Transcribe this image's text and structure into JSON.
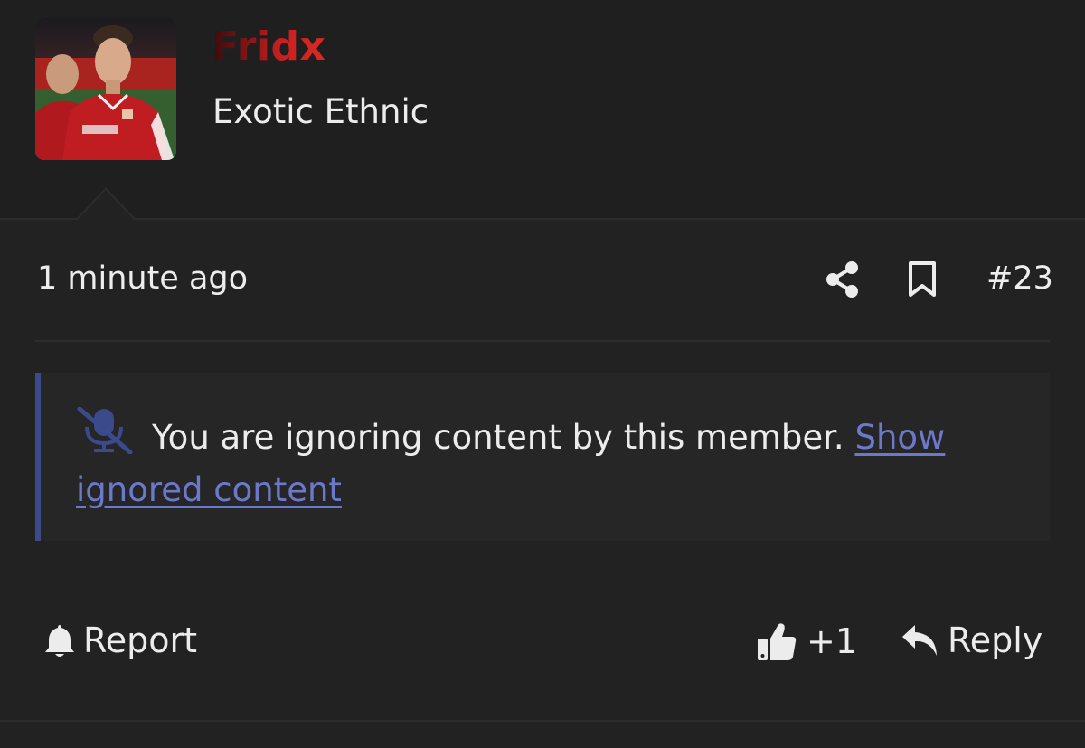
{
  "user": {
    "username": "Fridx",
    "user_title": "Exotic Ethnic",
    "avatar_icon": "avatar-photo"
  },
  "post": {
    "time": "1 minute ago",
    "number": "#23",
    "share_icon": "share-icon",
    "bookmark_icon": "bookmark-icon"
  },
  "ignored": {
    "message": "You are ignoring content by this member.",
    "link_text": "Show ignored content",
    "icon": "muted-microphone-icon"
  },
  "actions": {
    "report_label": "Report",
    "like_label": "+1",
    "reply_label": "Reply"
  },
  "colors": {
    "background": "#222223",
    "username_gradient_end": "#d72a24",
    "link": "#6c78c9",
    "quote_border": "#3b4a8a"
  }
}
